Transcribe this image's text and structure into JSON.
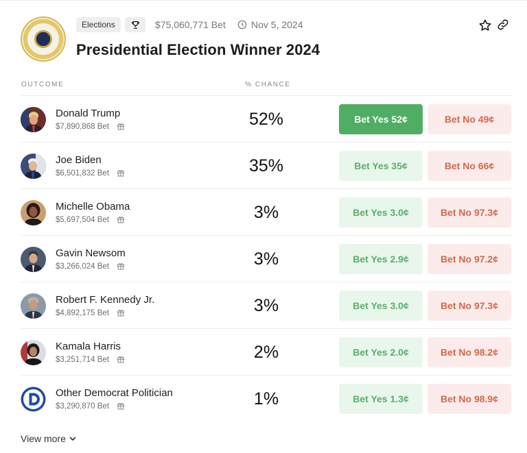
{
  "header": {
    "tag_label": "Elections",
    "volume": "$75,060,771 Bet",
    "date": "Nov 5, 2024",
    "title": "Presidential Election Winner 2024",
    "icons": {
      "seal": "presidential-seal-logo",
      "trophy": "trophy-icon",
      "clock": "clock-icon",
      "star": "star-icon",
      "link": "link-icon"
    }
  },
  "table": {
    "columns": [
      "OUTCOME",
      "% CHANCE"
    ],
    "rows": [
      {
        "name": "Donald Trump",
        "volume": "$7,890,868 Bet",
        "chance": "52%",
        "yes": "Bet Yes 52¢",
        "no": "Bet No 49¢",
        "yes_active": true,
        "avatar": "donald-trump-portrait"
      },
      {
        "name": "Joe Biden",
        "volume": "$6,501,832 Bet",
        "chance": "35%",
        "yes": "Bet Yes 35¢",
        "no": "Bet No 66¢",
        "yes_active": false,
        "avatar": "joe-biden-portrait"
      },
      {
        "name": "Michelle Obama",
        "volume": "$5,697,504 Bet",
        "chance": "3%",
        "yes": "Bet Yes 3.0¢",
        "no": "Bet No 97.3¢",
        "yes_active": false,
        "avatar": "michelle-obama-portrait"
      },
      {
        "name": "Gavin Newsom",
        "volume": "$3,266,024 Bet",
        "chance": "3%",
        "yes": "Bet Yes 2.9¢",
        "no": "Bet No 97.2¢",
        "yes_active": false,
        "avatar": "gavin-newsom-portrait"
      },
      {
        "name": "Robert F. Kennedy Jr.",
        "volume": "$4,892,175 Bet",
        "chance": "3%",
        "yes": "Bet Yes 3.0¢",
        "no": "Bet No 97.3¢",
        "yes_active": false,
        "avatar": "robert-f-kennedy-jr-portrait"
      },
      {
        "name": "Kamala Harris",
        "volume": "$3,251,714 Bet",
        "chance": "2%",
        "yes": "Bet Yes 2.0¢",
        "no": "Bet No 98.2¢",
        "yes_active": false,
        "avatar": "kamala-harris-portrait"
      },
      {
        "name": "Other Democrat Politician",
        "volume": "$3,290,870 Bet",
        "chance": "1%",
        "yes": "Bet Yes 1.3¢",
        "no": "Bet No 98.9¢",
        "yes_active": false,
        "avatar": "democratic-party-logo"
      }
    ]
  },
  "footer": {
    "view_more": "View more"
  },
  "colors": {
    "yes_active_bg": "#4fae63",
    "yes_bg": "#e9f6ec",
    "yes_text": "#5aad6d",
    "no_bg": "#fbeceb",
    "no_text": "#d6674a"
  }
}
